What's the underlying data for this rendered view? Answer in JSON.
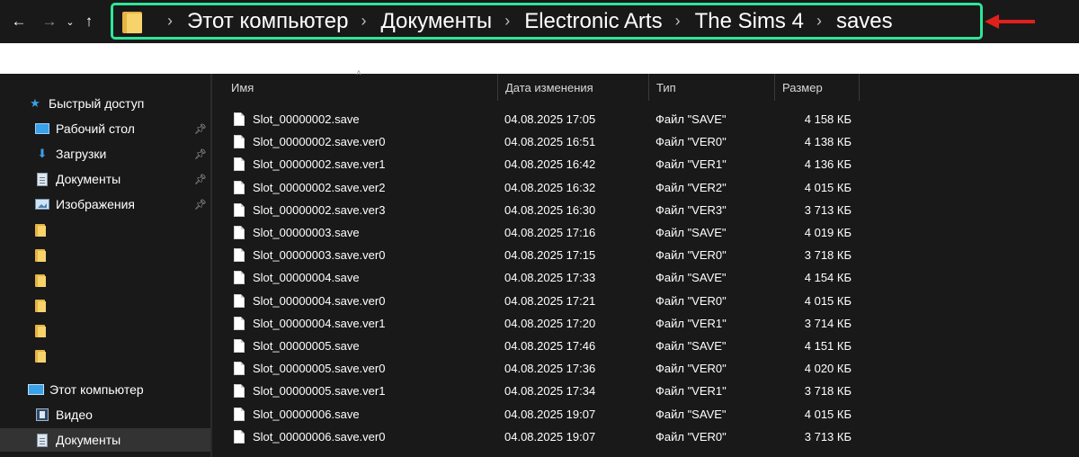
{
  "nav": {
    "back_icon": "←",
    "forward_icon": "→",
    "recent_icon": "⌄",
    "up_icon": "↑"
  },
  "breadcrumb": [
    "Этот компьютер",
    "Документы",
    "Electronic Arts",
    "The Sims 4",
    "saves"
  ],
  "colors": {
    "highlight_border": "#2ee59a",
    "arrow": "#e0201b",
    "background": "#191919"
  },
  "sidebar": {
    "quick_access": "Быстрый доступ",
    "pinned": [
      {
        "label": "Рабочий стол",
        "icon": "desktop-icon"
      },
      {
        "label": "Загрузки",
        "icon": "download-icon"
      },
      {
        "label": "Документы",
        "icon": "documents-icon"
      },
      {
        "label": "Изображения",
        "icon": "pictures-icon"
      }
    ],
    "pc": "Этот компьютер",
    "pc_items": [
      {
        "label": "Видео",
        "icon": "video-icon"
      },
      {
        "label": "Документы",
        "icon": "documents-icon"
      }
    ]
  },
  "columns": {
    "name": "Имя",
    "date": "Дата изменения",
    "type": "Тип",
    "size": "Размер"
  },
  "files": [
    {
      "name": "Slot_00000002.save",
      "date": "04.08.2025 17:05",
      "type": "Файл \"SAVE\"",
      "size": "4 158 КБ"
    },
    {
      "name": "Slot_00000002.save.ver0",
      "date": "04.08.2025 16:51",
      "type": "Файл \"VER0\"",
      "size": "4 138 КБ"
    },
    {
      "name": "Slot_00000002.save.ver1",
      "date": "04.08.2025 16:42",
      "type": "Файл \"VER1\"",
      "size": "4 136 КБ"
    },
    {
      "name": "Slot_00000002.save.ver2",
      "date": "04.08.2025 16:32",
      "type": "Файл \"VER2\"",
      "size": "4 015 КБ"
    },
    {
      "name": "Slot_00000002.save.ver3",
      "date": "04.08.2025 16:30",
      "type": "Файл \"VER3\"",
      "size": "3 713 КБ"
    },
    {
      "name": "Slot_00000003.save",
      "date": "04.08.2025 17:16",
      "type": "Файл \"SAVE\"",
      "size": "4 019 КБ"
    },
    {
      "name": "Slot_00000003.save.ver0",
      "date": "04.08.2025 17:15",
      "type": "Файл \"VER0\"",
      "size": "3 718 КБ"
    },
    {
      "name": "Slot_00000004.save",
      "date": "04.08.2025 17:33",
      "type": "Файл \"SAVE\"",
      "size": "4 154 КБ"
    },
    {
      "name": "Slot_00000004.save.ver0",
      "date": "04.08.2025 17:21",
      "type": "Файл \"VER0\"",
      "size": "4 015 КБ"
    },
    {
      "name": "Slot_00000004.save.ver1",
      "date": "04.08.2025 17:20",
      "type": "Файл \"VER1\"",
      "size": "3 714 КБ"
    },
    {
      "name": "Slot_00000005.save",
      "date": "04.08.2025 17:46",
      "type": "Файл \"SAVE\"",
      "size": "4 151 КБ"
    },
    {
      "name": "Slot_00000005.save.ver0",
      "date": "04.08.2025 17:36",
      "type": "Файл \"VER0\"",
      "size": "4 020 КБ"
    },
    {
      "name": "Slot_00000005.save.ver1",
      "date": "04.08.2025 17:34",
      "type": "Файл \"VER1\"",
      "size": "3 718 КБ"
    },
    {
      "name": "Slot_00000006.save",
      "date": "04.08.2025 19:07",
      "type": "Файл \"SAVE\"",
      "size": "4 015 КБ"
    },
    {
      "name": "Slot_00000006.save.ver0",
      "date": "04.08.2025 19:07",
      "type": "Файл \"VER0\"",
      "size": "3 713 КБ"
    }
  ]
}
